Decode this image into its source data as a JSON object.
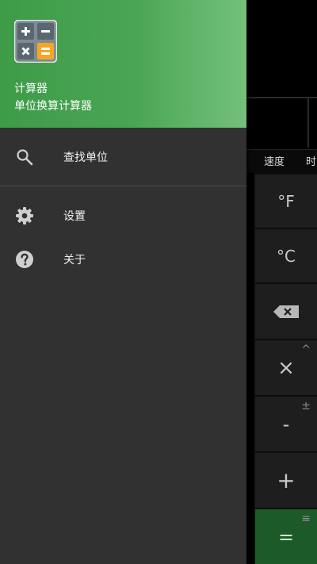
{
  "background": {
    "tabs": [
      "速度",
      "时"
    ],
    "keys": {
      "fahrenheit": "°F",
      "celsius": "°C",
      "multiply": "×",
      "multiply_alt": "^",
      "minus": "-",
      "minus_alt": "±",
      "plus": "+",
      "equals": "=",
      "equals_alt": "≡"
    }
  },
  "drawer": {
    "app_title": "计算器",
    "app_subtitle": "单位换算计算器",
    "menu": [
      {
        "label": "查找单位",
        "icon": "search-icon"
      },
      {
        "label": "设置",
        "icon": "gear-icon"
      },
      {
        "label": "关于",
        "icon": "help-icon"
      }
    ]
  },
  "colors": {
    "header_green": "#4aa654",
    "drawer_bg": "#313131",
    "equals_key": "#1d5a2a",
    "icon_orange": "#f5a623"
  }
}
